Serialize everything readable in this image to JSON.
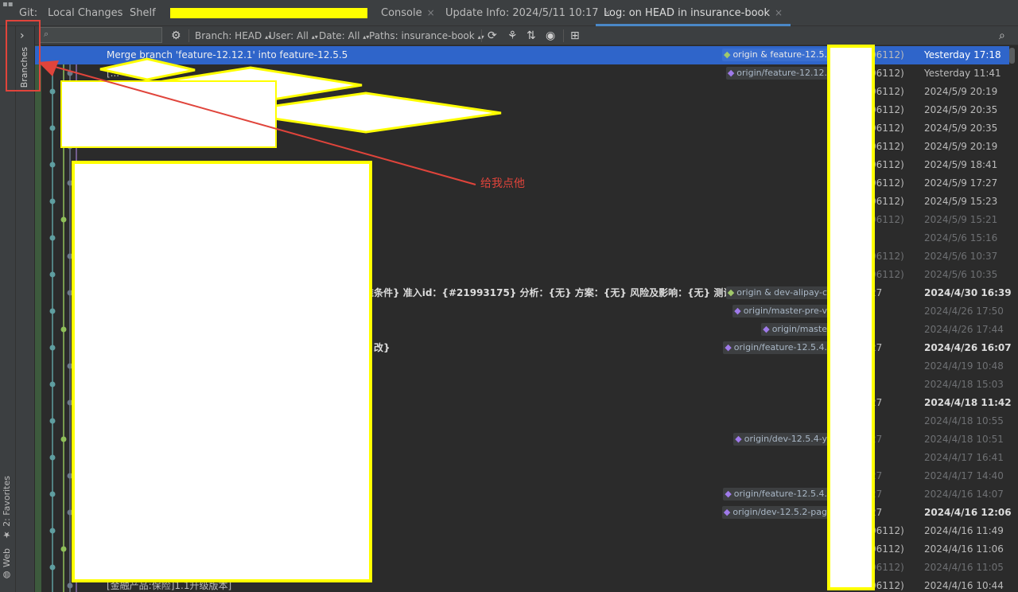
{
  "tabbar": {
    "git_label": "Git:",
    "tabs": [
      {
        "label": "Local Changes",
        "closable": false
      },
      {
        "label": "Shelf",
        "closable": false
      },
      {
        "label": "Console",
        "closable": true
      },
      {
        "label": "Update Info: 2024/5/11 10:17",
        "closable": true
      },
      {
        "label": "Log: on HEAD in insurance-book",
        "closable": true
      }
    ],
    "close_glyph": "×"
  },
  "left_stripe": {
    "favorites": "2: Favorites",
    "web": "Web"
  },
  "branches_panel": {
    "label": "Branches",
    "toggle_glyph": "›"
  },
  "toolbar": {
    "search_placeholder": "",
    "branch_filter": "Branch: HEAD",
    "user_filter": "User: All",
    "date_filter": "Date: All",
    "paths_filter": "Paths: insurance-book",
    "icons": [
      "gear-icon",
      "refresh-icon",
      "cherry-pick-icon",
      "sort-icon",
      "eye-icon",
      "new-tab-icon",
      "search-icon"
    ]
  },
  "commits": [
    {
      "subject": "Merge branch 'feature-12.12.1' into feature-12.5.5",
      "ref": "origin & feature-12.5.",
      "ref_type": "local",
      "hash": "06112)",
      "date": "Yesterday 17:18",
      "selected": true
    },
    {
      "subject": "[...",
      "ref": "origin/feature-12.12.",
      "ref_type": "remote",
      "hash": "06112)",
      "date": "Yesterday 11:41"
    },
    {
      "subject": "[...",
      "ref": "",
      "hash": "06112)",
      "date": "2024/5/9 20:19"
    },
    {
      "subject": "",
      "ref": "",
      "hash": "06112)",
      "date": "2024/5/9 20:35"
    },
    {
      "subject": "",
      "ref": "",
      "hash": "06112)",
      "date": "2024/5/9 20:35"
    },
    {
      "subject": "",
      "ref": "",
      "hash": "06112)",
      "date": "2024/5/9 20:19"
    },
    {
      "subject": "",
      "ref": "",
      "hash": "06112)",
      "date": "2024/5/9 18:41"
    },
    {
      "subject": "",
      "ref": "",
      "hash": "06112)",
      "date": "2024/5/9 17:27"
    },
    {
      "subject": "",
      "ref": "",
      "hash": "06112)",
      "date": "2024/5/9 15:23"
    },
    {
      "subject": "",
      "ref": "",
      "hash": "06112)",
      "date": "2024/5/9 15:21",
      "dim": true
    },
    {
      "subject": "",
      "ref": "",
      "hash": "",
      "date": "2024/5/6 15:16",
      "dim": true
    },
    {
      "subject": "",
      "ref": "",
      "hash": "06112)",
      "date": "2024/5/6 10:37",
      "dim": true
    },
    {
      "subject": "",
      "ref": "",
      "hash": "06112)",
      "date": "2024/5/6 10:35",
      "dim": true
    },
    {
      "subject": "准条件} 准入id：{#21993175} 分析：{无} 方案：{无} 风险及影响：{无} 测试建议：{无",
      "ref": "origin & dev-alipay-c",
      "ref_type": "local",
      "hash": "27",
      "date": "2024/4/30 16:39",
      "bold": true
    },
    {
      "subject": "",
      "ref": "origin/master-pre-v",
      "ref_type": "remote",
      "hash": "",
      "date": "2024/4/26 17:50",
      "dim": true
    },
    {
      "subject": "",
      "ref": "origin/maste",
      "ref_type": "remote",
      "hash": "",
      "date": "2024/4/26 17:44",
      "dim": true
    },
    {
      "subject": "改}",
      "ref": "origin/feature-12.5.4.",
      "ref_type": "remote",
      "hash": "27",
      "date": "2024/4/26 16:07",
      "bold": true
    },
    {
      "subject": "",
      "ref": "",
      "hash": "",
      "date": "2024/4/19 10:48",
      "dim": true
    },
    {
      "subject": "",
      "ref": "",
      "hash": "",
      "date": "2024/4/18 15:03",
      "dim": true
    },
    {
      "subject": "",
      "ref": "",
      "hash": "27",
      "date": "2024/4/18 11:42",
      "bold": true
    },
    {
      "subject": "",
      "ref": "",
      "hash": "",
      "date": "2024/4/18 10:55",
      "dim": true
    },
    {
      "subject": "",
      "ref": "origin/dev-12.5.4-y",
      "ref_type": "remote",
      "hash": "27",
      "date": "2024/4/18 10:51",
      "dim": true
    },
    {
      "subject": "",
      "ref": "",
      "hash": "",
      "date": "2024/4/17 16:41",
      "dim": true
    },
    {
      "subject": "",
      "ref": "",
      "hash": "27",
      "date": "2024/4/17 14:40",
      "dim": true
    },
    {
      "subject": "",
      "ref": "origin/feature-12.5.4.",
      "ref_type": "remote",
      "hash": "27",
      "date": "2024/4/16 14:07",
      "dim": true
    },
    {
      "subject": "",
      "ref": "origin/dev-12.5.2-pag",
      "ref_type": "remote",
      "hash": "27",
      "date": "2024/4/16 12:06",
      "bold": true
    },
    {
      "subject": "",
      "ref": "",
      "hash": "06112)",
      "date": "2024/4/16 11:49"
    },
    {
      "subject": "",
      "ref": "",
      "hash": "06112)",
      "date": "2024/4/16 11:06"
    },
    {
      "subject": "",
      "ref": "",
      "hash": "06112)",
      "date": "2024/4/16 11:05",
      "dim": true
    },
    {
      "subject": "[金融产品:保险]1.1升级版本]",
      "ref": "",
      "hash": "06112)",
      "date": "2024/4/16 10:44"
    }
  ],
  "annotation": {
    "text": "给我点他",
    "color": "#e0443b"
  },
  "colors": {
    "selection": "#2f65ca",
    "redaction": "#ffff00",
    "tag": "#9f7aea",
    "accent_tab": "#4a88c7"
  }
}
